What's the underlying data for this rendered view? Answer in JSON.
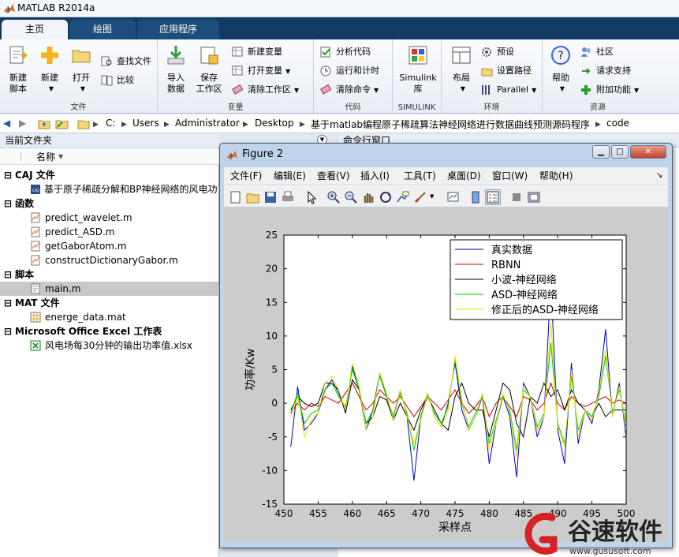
{
  "window": {
    "title": "MATLAB R2014a"
  },
  "tabs": [
    {
      "label": "主页"
    },
    {
      "label": "绘图"
    },
    {
      "label": "应用程序"
    }
  ],
  "ribbon": {
    "file": {
      "label": "文件",
      "new_script": "新建\n脚本",
      "new": "新建",
      "open": "打开",
      "find_files": "查找文件",
      "compare": "比较"
    },
    "variable": {
      "label": "变量",
      "import_data": "导入\n数据",
      "save_workspace": "保存\n工作区",
      "new_variable": "新建变量",
      "open_variable": "打开变量",
      "clear_workspace": "清除工作区"
    },
    "code": {
      "label": "代码",
      "analyze_code": "分析代码",
      "run_and_time": "运行和计时",
      "clear_commands": "清除命令"
    },
    "simulink": {
      "label": "SIMULINK",
      "simulink_library": "Simulink\n库"
    },
    "environment": {
      "label": "环境",
      "layout": "布局",
      "preferences": "预设",
      "set_path": "设置路径",
      "parallel": "Parallel"
    },
    "resources": {
      "label": "资源",
      "help": "帮助",
      "community": "社区",
      "request_support": "请求支持",
      "add_ons": "附加功能"
    }
  },
  "address": {
    "crumbs": [
      "C:",
      "Users",
      "Administrator",
      "Desktop",
      "基于matlab编程原子稀疏算法神经网络进行数据曲线预测源码程序",
      "code"
    ]
  },
  "file_panel": {
    "title": "当前文件夹",
    "column_name": "名称",
    "sections": [
      {
        "label": "CAJ 文件",
        "items": [
          "基于原子稀疏分解和BP神经网络的风电功"
        ]
      },
      {
        "label": "函数",
        "items": [
          "predict_wavelet.m",
          "predict_ASD.m",
          "getGaborAtom.m",
          "constructDictionaryGabor.m"
        ]
      },
      {
        "label": "脚本",
        "items": [
          "main.m"
        ]
      },
      {
        "label": "MAT 文件",
        "items": [
          "energe_data.mat"
        ]
      },
      {
        "label": "Microsoft Office Excel 工作表",
        "items": [
          "风电场每30分钟的输出功率值.xlsx"
        ]
      }
    ]
  },
  "command_window": {
    "title": "命令行窗口"
  },
  "figure": {
    "title": "Figure 2",
    "menu": [
      "文件(F)",
      "编辑(E)",
      "查看(V)",
      "插入(I)",
      "工具(T)",
      "桌面(D)",
      "窗口(W)",
      "帮助(H)"
    ]
  },
  "chart_data": {
    "type": "line",
    "xlabel": "采样点",
    "ylabel": "功率/Kw",
    "xlim": [
      450,
      500
    ],
    "ylim": [
      -15,
      25
    ],
    "xticks": [
      450,
      455,
      460,
      465,
      470,
      475,
      480,
      485,
      490,
      495,
      500
    ],
    "yticks": [
      -15,
      -10,
      -5,
      0,
      5,
      10,
      15,
      20,
      25
    ],
    "legend_position": "top-right",
    "x": [
      451,
      452,
      453,
      454,
      455,
      456,
      457,
      458,
      459,
      460,
      461,
      462,
      463,
      464,
      465,
      466,
      467,
      468,
      469,
      470,
      471,
      472,
      473,
      474,
      475,
      476,
      477,
      478,
      479,
      480,
      481,
      482,
      483,
      484,
      485,
      486,
      487,
      488,
      489,
      490,
      491,
      492,
      493,
      494,
      495,
      496,
      497,
      498,
      499,
      500
    ],
    "series": [
      {
        "name": "真实数据",
        "color": "#0000cc",
        "values": [
          -6.5,
          2.5,
          -4,
          -3,
          -1.5,
          2,
          3.5,
          1.5,
          -1,
          5.5,
          2,
          -4,
          -1,
          4.5,
          1,
          -2,
          2,
          -2,
          -11.5,
          -2,
          1.5,
          -2,
          -3.5,
          0,
          6,
          -1,
          -4,
          -2,
          1,
          -9,
          -3,
          1,
          -2,
          -11,
          3,
          1,
          -5,
          -2,
          18,
          -4,
          -9,
          6,
          -6,
          -1,
          -3,
          2,
          11,
          -2,
          3,
          -5
        ]
      },
      {
        "name": "RBNN",
        "color": "#cc0000",
        "values": [
          -1.5,
          0,
          -1,
          0,
          -0.5,
          1,
          0.5,
          0,
          1.5,
          3,
          1,
          -1,
          0,
          2,
          1,
          0,
          1,
          -0.5,
          -2,
          -0.5,
          1,
          0,
          -1,
          0.5,
          2,
          0,
          -1.5,
          -0.5,
          1,
          -2,
          0,
          1,
          -0.5,
          -2,
          1,
          0.5,
          -1,
          0,
          3,
          0,
          -1,
          1,
          0,
          -0.5,
          0,
          0.5,
          1,
          0,
          0.5,
          0
        ]
      },
      {
        "name": "小波-神经网络",
        "color": "#000000",
        "values": [
          -1,
          1,
          0,
          -0.5,
          0,
          3,
          3,
          2,
          -1.5,
          3.5,
          2,
          -3,
          -2,
          1,
          0.5,
          -2.5,
          0,
          -2,
          -4,
          -1,
          1,
          -1,
          -3,
          -4,
          1,
          3,
          0,
          -1,
          -1,
          -5,
          -1,
          3,
          2,
          -3,
          -5,
          1,
          0,
          3,
          1,
          2,
          -1,
          2,
          0,
          -1,
          -2,
          0,
          -2,
          -1,
          -1,
          -1
        ]
      },
      {
        "name": "ASD-神经网络",
        "color": "#00cc00",
        "values": [
          -1.5,
          1.5,
          -3,
          -1.5,
          -1,
          2,
          3,
          1,
          -0.5,
          5,
          2,
          -3,
          -1,
          4,
          1,
          -2,
          1.5,
          -1.5,
          -7,
          -2,
          1,
          -1.5,
          -3,
          -0.5,
          6.5,
          0,
          -3.5,
          -1.5,
          1,
          -6,
          -2.5,
          1,
          -1,
          -7,
          2,
          1,
          -3.5,
          -1.5,
          9,
          -3,
          -6,
          4,
          -4,
          -1,
          -2,
          1,
          7,
          -1.5,
          2,
          -3
        ]
      },
      {
        "name": "修正后的ASD-神经网络",
        "color": "#e6e600",
        "values": [
          -2,
          1,
          -5,
          -2.5,
          -1.5,
          3,
          4,
          2,
          -1,
          6,
          2.5,
          -4,
          -2,
          4.5,
          1.5,
          -2.5,
          2,
          -2,
          -6,
          -2.5,
          1.5,
          -2,
          -3.5,
          -1,
          7,
          0.5,
          -4,
          -2,
          1.5,
          -7,
          -3,
          1.5,
          -1.5,
          -8,
          2.5,
          1,
          -4,
          -2,
          12,
          -3.5,
          -6.5,
          5,
          -5,
          -1,
          -2.5,
          1.5,
          8,
          -2,
          2.5,
          -4
        ]
      }
    ]
  },
  "watermark": {
    "text": "谷速软件",
    "url": "www.gususoft.com"
  }
}
